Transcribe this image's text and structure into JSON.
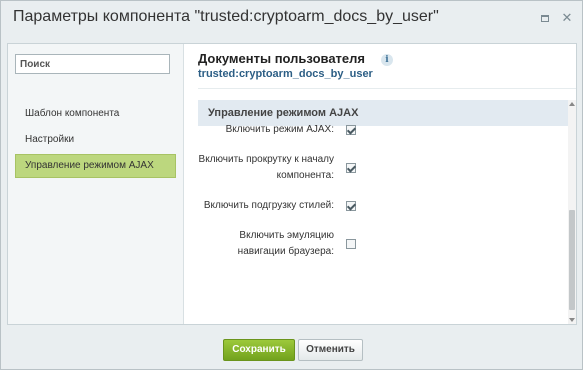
{
  "window": {
    "title": "Параметры компонента \"trusted:cryptoarm_docs_by_user\"",
    "maximize_icon": "maximize-icon",
    "close_icon": "close-icon",
    "close_glyph": "✕"
  },
  "sidebar": {
    "search_placeholder": "Поиск",
    "search_value": "",
    "items": [
      {
        "label": "Шаблон компонента",
        "active": false
      },
      {
        "label": "Настройки",
        "active": false
      },
      {
        "label": "Управление режимом AJAX",
        "active": true
      }
    ]
  },
  "header": {
    "title": "Документы пользователя",
    "subtitle": "trusted:cryptoarm_docs_by_user",
    "info_icon": "info-icon",
    "info_glyph": "i"
  },
  "section": {
    "title": "Управление режимом AJAX",
    "rows": [
      {
        "label": "Включить режим AJAX:",
        "checked": true
      },
      {
        "label": "Включить прокрутку к началу компонента:",
        "checked": true
      },
      {
        "label": "Включить подгрузку стилей:",
        "checked": true
      },
      {
        "label": "Включить эмуляцию навигации браузера:",
        "checked": false
      }
    ]
  },
  "footer": {
    "save_label": "Сохранить",
    "cancel_label": "Отменить"
  },
  "colors": {
    "active_nav": "#bcd77e",
    "save_button": "#85b52b",
    "subtitle_link": "#2c5e85",
    "section_header": "#e2eaf1"
  }
}
